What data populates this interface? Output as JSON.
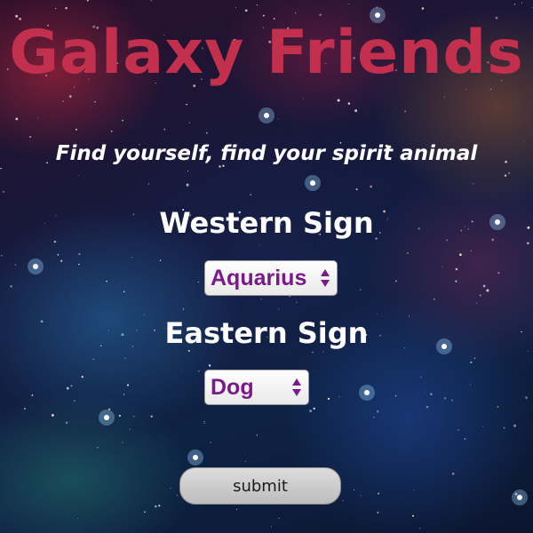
{
  "app": {
    "title": "Galaxy Friends",
    "tagline": "Find yourself, find your spirit animal"
  },
  "form": {
    "western": {
      "label": "Western Sign",
      "selected": "Aquarius"
    },
    "eastern": {
      "label": "Eastern Sign",
      "selected": "Dog"
    },
    "submit_label": "submit"
  },
  "colors": {
    "title": "#c3304e",
    "select_text": "#7a1a8a",
    "arrow": "#7a1a8a",
    "label_text": "#ffffff"
  },
  "icons": {
    "select_arrows": "up-down-chevron-icon"
  }
}
